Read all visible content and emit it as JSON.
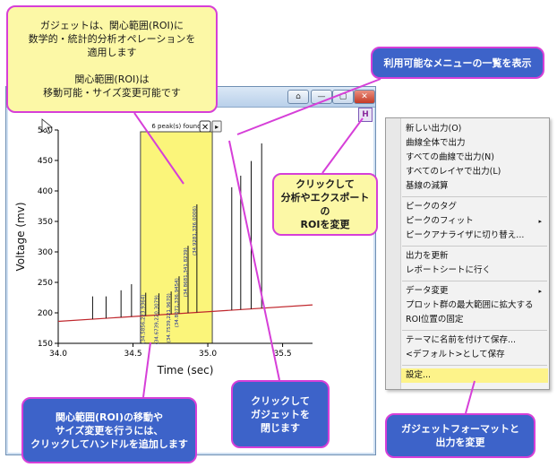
{
  "window": {
    "buttons": [
      "⌂",
      "—",
      "▢",
      "✕"
    ]
  },
  "gadget": {
    "peaks_found": "6 peak(s) found",
    "close_glyph": "✕",
    "expand_glyph": "▸",
    "h_button": "H"
  },
  "chart_data": {
    "type": "line",
    "xlabel": "Time (sec)",
    "ylabel": "Voltage (mv)",
    "xlim": [
      34.0,
      35.7
    ],
    "ylim": [
      150,
      500
    ],
    "x_ticks": [
      "34.0",
      "34.5",
      "35.0",
      "35.5"
    ],
    "y_ticks": [
      "150",
      "200",
      "250",
      "300",
      "350",
      "400",
      "450",
      "500"
    ],
    "x_tick_values": [
      34.0,
      34.5,
      35.0,
      35.5
    ],
    "y_tick_values": [
      150,
      200,
      250,
      300,
      350,
      400,
      450,
      500
    ],
    "roi": {
      "x_from": 34.55,
      "x_to": 35.03
    },
    "baseline": {
      "x": [
        34.0,
        35.7
      ],
      "y": [
        186,
        213
      ]
    },
    "peaks": [
      {
        "x": 34.23,
        "y": 227
      },
      {
        "x": 34.32,
        "y": 227
      },
      {
        "x": 34.42,
        "y": 237
      },
      {
        "x": 34.49,
        "y": 247
      },
      {
        "x": 34.585,
        "y": 233
      },
      {
        "x": 34.673,
        "y": 232
      },
      {
        "x": 34.755,
        "y": 235
      },
      {
        "x": 34.808,
        "y": 260
      },
      {
        "x": 34.868,
        "y": 310
      },
      {
        "x": 34.927,
        "y": 378
      },
      {
        "x": 35.16,
        "y": 406
      },
      {
        "x": 35.22,
        "y": 425
      },
      {
        "x": 35.29,
        "y": 449
      },
      {
        "x": 35.36,
        "y": 478
      }
    ],
    "peak_labels": [
      {
        "x": 34.585,
        "text": "(34.5856,223.9364)"
      },
      {
        "x": 34.673,
        "text": "(34.6739,220.3079)"
      },
      {
        "x": 34.755,
        "text": "(34.7539,221.9670)"
      },
      {
        "x": 34.808,
        "text": "(34.8071,336.9454)"
      },
      {
        "x": 34.868,
        "text": "(34.8681,341.8239)"
      },
      {
        "x": 34.927,
        "text": "(34.9281,336.0006)"
      }
    ]
  },
  "callouts": {
    "gadget_desc": "ガジェットは、関心範囲(ROI)に\n数学的・統計的分析オペレーションを\n適用します\n\n関心範囲(ROI)は\n移動可能・サイズ変更可能です",
    "menu_list": "利用可能なメニューの一覧を表示",
    "click_roi": "クリックして\n分析やエクスポートの\nROIを変更",
    "add_handle": "関心範囲(ROI)の移動や\nサイズ変更を行うには、\nクリックしてハンドルを追加します",
    "close_gadget": "クリックして\nガジェットを\n閉じます",
    "format": "ガジェットフォーマットと\n出力を変更"
  },
  "menu": {
    "items": [
      {
        "label": "新しい出力(O)"
      },
      {
        "label": "曲線全体で出力"
      },
      {
        "label": "すべての曲線で出力(N)"
      },
      {
        "label": "すべてのレイヤで出力(L)"
      },
      {
        "label": "基線の減算"
      },
      {
        "label": "ピークのタグ"
      },
      {
        "label": "ピークのフィット",
        "submenu": "▸"
      },
      {
        "label": "ピークアナライザに切り替え..."
      },
      {
        "label": "出力を更新"
      },
      {
        "label": "レポートシートに行く"
      },
      {
        "label": "データ変更",
        "submenu": "▸"
      },
      {
        "label": "プロット群の最大範囲に拡大する"
      },
      {
        "label": "ROI位置の固定"
      },
      {
        "label": "テーマに名前を付けて保存..."
      },
      {
        "label": "<デフォルト>として保存"
      },
      {
        "label": "設定..."
      }
    ]
  },
  "colors": {
    "roi_fill": "#fbf57a",
    "baseline": "#c0272d",
    "callout_blue": "#3d63c9",
    "callout_border": "#d63fd8",
    "menu_highlight": "#fdf38a"
  }
}
